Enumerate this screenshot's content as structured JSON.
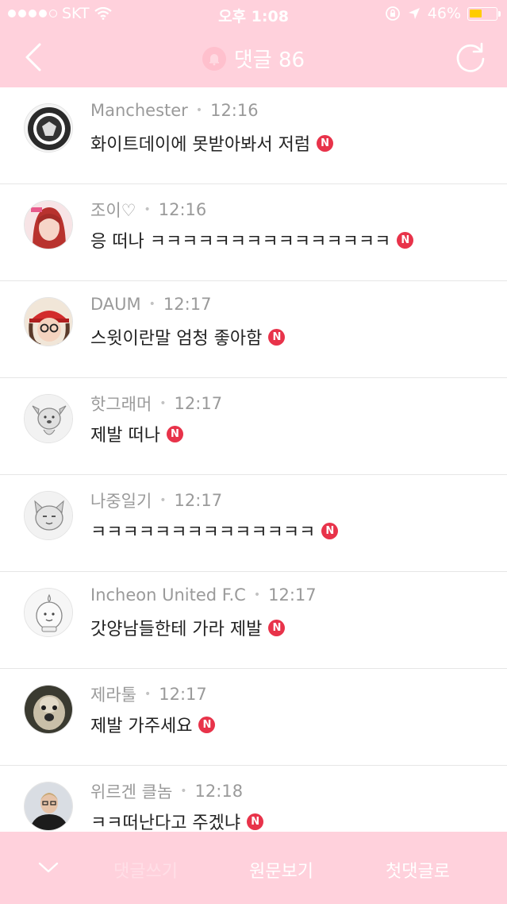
{
  "status_bar": {
    "carrier": "SKT",
    "time": "오후 1:08",
    "battery_percent": "46%",
    "battery_level": 0.46,
    "signal_bars": 4
  },
  "nav": {
    "title": "댓글 86",
    "back_icon": "chevron-left-icon",
    "refresh_icon": "refresh-icon"
  },
  "comments": [
    {
      "author": "Manchester",
      "time": "12:16",
      "text": "화이트데이에 못받아봐서 저럼",
      "badge": "N"
    },
    {
      "author": "조이♡",
      "time": "12:16",
      "text": "응 떠나 ㅋㅋㅋㅋㅋㅋㅋㅋㅋㅋㅋㅋㅋㅋㅋ",
      "badge": "N"
    },
    {
      "author": "DAUM",
      "time": "12:17",
      "text": "스윗이란말 엄청 좋아함",
      "badge": "N"
    },
    {
      "author": "핫그래머",
      "time": "12:17",
      "text": "제발 떠나",
      "badge": "N"
    },
    {
      "author": "나중일기",
      "time": "12:17",
      "text": "ㅋㅋㅋㅋㅋㅋㅋㅋㅋㅋㅋㅋㅋㅋ",
      "badge": "N"
    },
    {
      "author": "Incheon United F.C",
      "time": "12:17",
      "text": "갓양남들한테 가라 제발",
      "badge": "N"
    },
    {
      "author": "제라툴",
      "time": "12:17",
      "text": "제발 가주세요",
      "badge": "N"
    },
    {
      "author": "위르겐 클놈",
      "time": "12:18",
      "text": "ㅋㅋ떠난다고 주겠냐",
      "badge": "N"
    }
  ],
  "bottom_bar": {
    "write_comment": "댓글쓰기",
    "view_original": "원문보기",
    "first_comment": "첫댓글로"
  },
  "colors": {
    "header_pink": "#ffd1dc",
    "badge_red": "#e8334a",
    "battery_yellow": "#ffcc00"
  }
}
